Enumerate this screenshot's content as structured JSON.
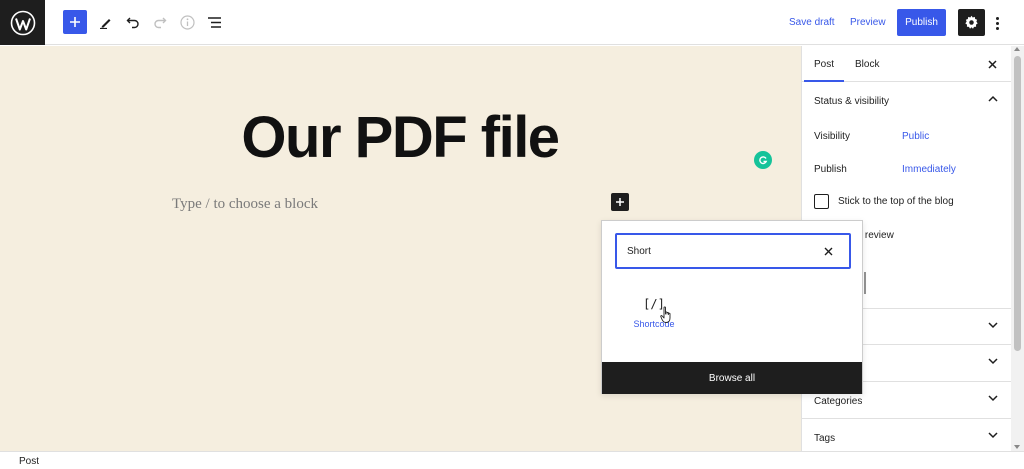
{
  "toolbar": {
    "logo_icon": "wordpress-logo-icon",
    "add_icon": "plus-icon",
    "tools_icon": "pencil-icon",
    "undo_icon": "undo-icon",
    "redo_icon": "redo-icon",
    "details_icon": "info-icon",
    "outline_icon": "list-view-icon",
    "save_draft_label": "Save draft",
    "preview_label": "Preview",
    "publish_label": "Publish",
    "settings_icon": "gear-icon",
    "options_icon": "more-vertical-icon",
    "accent_color": "#3858e9"
  },
  "canvas": {
    "background_color": "#f5eedf",
    "post_title": "Our PDF file",
    "block_placeholder": "Type / to choose a block",
    "grammarly_icon": "grammarly-icon"
  },
  "inserter": {
    "search_value": "Short",
    "results": [
      {
        "label": "Shortcode",
        "icon_text": "[/]"
      }
    ],
    "browse_all_label": "Browse all"
  },
  "sidebar": {
    "tabs": [
      {
        "label": "Post",
        "active": true
      },
      {
        "label": "Block",
        "active": false
      }
    ],
    "status_panel": {
      "title": "Status & visibility",
      "visibility_label": "Visibility",
      "visibility_value": "Public",
      "publish_label": "Publish",
      "publish_value": "Immediately",
      "stick_label": "Stick to the top of the blog",
      "pending_label_partial": "ng review"
    },
    "collapsed_panels": [
      {
        "label": ""
      },
      {
        "label": ""
      },
      {
        "label": "Categories"
      },
      {
        "label": "Tags"
      }
    ]
  },
  "footer": {
    "breadcrumb": "Post"
  }
}
